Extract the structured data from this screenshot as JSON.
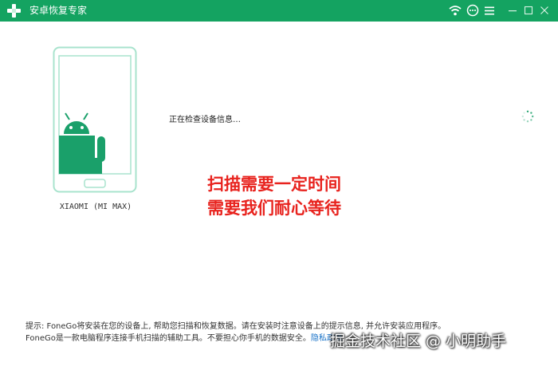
{
  "app": {
    "title": "安卓恢复专家"
  },
  "device": {
    "name": "XIAOMI (MI MAX)"
  },
  "status": {
    "text": "正在检查设备信息…"
  },
  "overlay_note": {
    "line1": "扫描需要一定时间",
    "line2": "需要我们耐心等待"
  },
  "tips": {
    "line1": "提示: FoneGo将安装在您的设备上, 帮助您扫描和恢复数据。请在安装时注意设备上的提示信息, 并允许安装应用程序。",
    "line2": "FoneGo是一款电脑程序连接手机扫描的辅助工具。不要担心你手机的数据安全。",
    "privacy_link": "隐私政策"
  },
  "watermark": {
    "text": "掘金技术社区 @ 小明助手"
  },
  "colors": {
    "titlebar": "#14a361",
    "phone_outline": "#a8e3cd",
    "android": "#1aa06a",
    "overlay_text": "#e8231e",
    "link": "#1a73c8"
  },
  "icons": {
    "titlebar": [
      "wifi-icon",
      "chat-icon",
      "menu-icon",
      "minimize-icon",
      "maximize-icon",
      "close-icon"
    ]
  }
}
